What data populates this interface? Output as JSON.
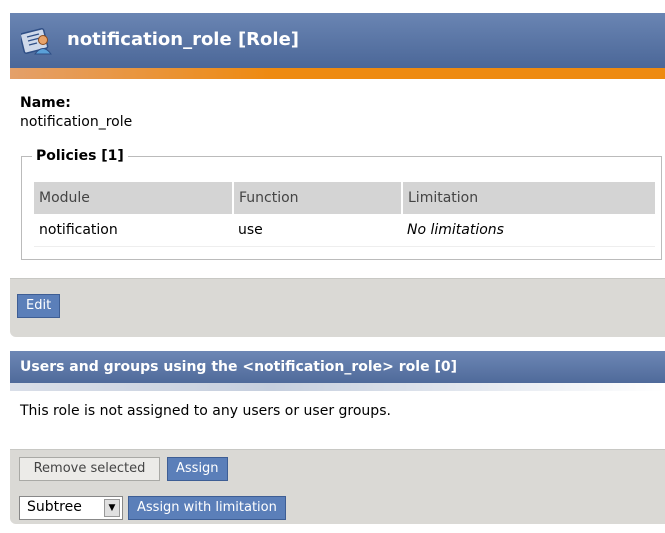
{
  "role": {
    "title": "notification_role [Role]",
    "name_label": "Name:",
    "name_value": "notification_role"
  },
  "policies": {
    "legend": "Policies [1]",
    "columns": [
      "Module",
      "Function",
      "Limitation"
    ],
    "rows": [
      {
        "module": "notification",
        "function": "use",
        "limitation": "No limitations"
      }
    ]
  },
  "buttons": {
    "edit": "Edit",
    "remove_selected": "Remove selected",
    "assign": "Assign",
    "assign_with_limitation": "Assign with limitation"
  },
  "assignments": {
    "title": "Users and groups using the <notification_role> role [0]",
    "empty_message": "This role is not assigned to any users or user groups.",
    "limitation_select": {
      "selected": "Subtree"
    }
  },
  "icons": {
    "role": "role-icon",
    "dropdown": "chevron-down-icon"
  },
  "colors": {
    "header_blue": "#4b6798",
    "accent_orange": "#ee8a10",
    "button_blue": "#5b7fb9"
  }
}
